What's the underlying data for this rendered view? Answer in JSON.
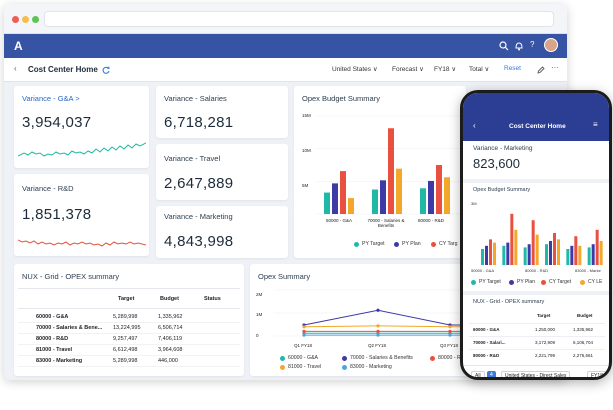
{
  "appbar": {
    "logo": "A"
  },
  "subbar": {
    "title": "Cost Center Home",
    "filters": [
      "United States ∨",
      "Forecast ∨",
      "FY18 ∨",
      "Total ∨"
    ],
    "reset": "Reset"
  },
  "kpis": [
    {
      "label": "Variance - G&A >",
      "value": "3,954,037"
    },
    {
      "label": "Variance - Salaries",
      "value": "6,718,281"
    },
    {
      "label": "Variance - Travel",
      "value": "2,647,889"
    },
    {
      "label": "Variance - R&D",
      "value": "1,851,378"
    },
    {
      "label": "Variance - Marketing",
      "value": "4,843,998"
    }
  ],
  "budget_chart": {
    "title": "Opex Budget Summary",
    "yticks": [
      "15M",
      "10M",
      "5M"
    ],
    "categories": [
      "50000 - G&A",
      "70000 - Salaries & Benefits",
      "80000 - R&D"
    ],
    "legend": [
      "PY Target",
      "PY Plan",
      "CY Targ"
    ]
  },
  "grid": {
    "title": "NUX - Grid - OPEX summary",
    "columns": [
      "Target",
      "Budget",
      "Status"
    ],
    "rows": [
      [
        "60000 - G&A",
        "5,289,998",
        "1,335,962"
      ],
      [
        "70000 - Salaries & Bene...",
        "13,224,995",
        "6,506,714"
      ],
      [
        "80000 - R&D",
        "9,257,497",
        "7,406,119"
      ],
      [
        "81000 - Travel",
        "6,612,498",
        "3,964,608"
      ],
      [
        "83000 - Marketing",
        "5,289,998",
        "446,000"
      ]
    ]
  },
  "opex_chart": {
    "title": "Opex Summary",
    "yticks": [
      "2M",
      "1M",
      "0"
    ],
    "xticks": [
      "Q1 FY18",
      "Q2 FY18",
      "Q3 FY18"
    ],
    "legend": [
      "60000 - G&A",
      "70000 - Salaries & Benefits",
      "80000 - R&D",
      "81000 - Travel",
      "83000 - Marketing"
    ]
  },
  "phone": {
    "title": "Cost Center Home",
    "kpi_label": "Variance - Marketing",
    "kpi_value": "823,600",
    "chart_title": "Opex Budget Summary",
    "ytick": "3M",
    "xlabels": [
      "50000 - G&A",
      "80000 - R&D",
      "83000 - Marke"
    ],
    "legend": [
      "PY Target",
      "PY Plan",
      "CY Target",
      "CY LE"
    ],
    "grid_title": "NUX - Grid - OPEX summary",
    "columns": [
      "Target",
      "Budget"
    ],
    "rows": [
      [
        "60000 - G&A",
        "1,250,000",
        "1,335,962"
      ],
      [
        "70000 - Salari...",
        "3,172,909",
        "6,106,704"
      ],
      [
        "80000 - R&D",
        "2,221,799",
        "2,276,661"
      ]
    ],
    "chips": [
      "All",
      "4",
      "United States - Direct Sales",
      "FY18"
    ]
  },
  "chart_data": [
    {
      "type": "bar",
      "title": "Opex Budget Summary",
      "categories": [
        "50000 - G&A",
        "70000 - Salaries & Benefits",
        "80000 - R&D"
      ],
      "ylim": [
        0,
        16
      ],
      "series": [
        {
          "name": "PY Target",
          "values": [
            3.5,
            4.0,
            4.2
          ]
        },
        {
          "name": "PY Plan",
          "values": [
            5.0,
            5.5,
            5.4
          ]
        },
        {
          "name": "CY Target",
          "values": [
            7.0,
            14.0,
            8.0
          ]
        },
        {
          "name": "CY LE",
          "values": [
            2.6,
            7.4,
            6.0
          ]
        }
      ]
    },
    {
      "type": "line",
      "title": "Opex Summary",
      "x": [
        "Q1 FY18",
        "Q2 FY18",
        "Q3 FY18"
      ],
      "ylim": [
        0,
        2.5
      ],
      "series": [
        {
          "name": "60000 - G&A",
          "values": [
            0.15,
            0.15,
            0.15
          ]
        },
        {
          "name": "70000 - Salaries & Benefits",
          "values": [
            0.6,
            1.4,
            0.6
          ]
        },
        {
          "name": "80000 - R&D",
          "values": [
            0.25,
            0.25,
            0.25
          ]
        },
        {
          "name": "81000 - Travel",
          "values": [
            0.5,
            0.55,
            0.5
          ]
        },
        {
          "name": "83000 - Marketing",
          "values": [
            0.05,
            0.05,
            0.05
          ]
        }
      ]
    },
    {
      "type": "bar",
      "title": "Opex Budget Summary",
      "categories": [
        "50000 - G&A",
        "80000 - R&D",
        "83000 - Marke"
      ],
      "ylim": [
        0,
        4
      ],
      "series": [
        {
          "name": "PY Target",
          "values": [
            1.0,
            1.2,
            1.1,
            1.3,
            1.0,
            1.1
          ]
        },
        {
          "name": "PY Plan",
          "values": [
            1.2,
            1.4,
            1.3,
            1.5,
            1.2,
            1.3
          ]
        },
        {
          "name": "CY Target",
          "values": [
            1.6,
            3.2,
            2.8,
            2.0,
            1.8,
            2.2
          ]
        },
        {
          "name": "CY LE",
          "values": [
            1.4,
            2.2,
            1.9,
            1.6,
            1.2,
            1.5
          ]
        }
      ]
    }
  ],
  "colors": {
    "appbar": "#3753a4",
    "teal": "#22b8a8",
    "navy": "#3d3aa6",
    "red": "#e9503f",
    "orange": "#f3a72b",
    "spark_teal": "#1fb8a2",
    "spark_red": "#e0533e"
  }
}
